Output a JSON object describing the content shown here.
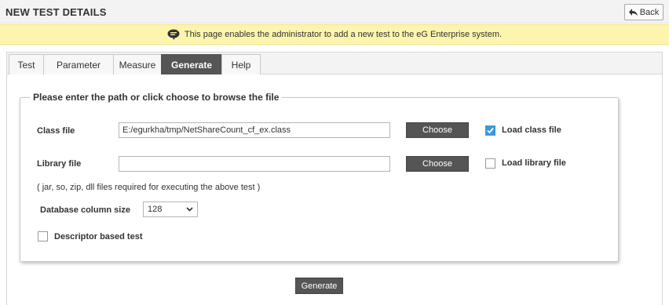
{
  "header": {
    "title": "NEW TEST DETAILS",
    "back_label": "Back"
  },
  "info": {
    "message": "This page enables the administrator to add a new test to the eG Enterprise system."
  },
  "tabs": [
    {
      "label": "Test",
      "active": false
    },
    {
      "label": "Parameter",
      "active": false
    },
    {
      "label": "Measure",
      "active": false
    },
    {
      "label": "Generate",
      "active": true
    },
    {
      "label": "Help",
      "active": false
    }
  ],
  "form": {
    "legend": "Please enter the path or click choose to browse the file",
    "class_file": {
      "label": "Class file",
      "value": "E:/egurkha/tmp/NetShareCount_cf_ex.class",
      "choose_label": "Choose",
      "load_label": "Load class file",
      "load_checked": true
    },
    "library_file": {
      "label": "Library file",
      "value": "",
      "choose_label": "Choose",
      "load_label": "Load library file",
      "load_checked": false
    },
    "note": "( jar, so, zip, dll files required for executing the above test )",
    "db_column_size": {
      "label": "Database column size",
      "value": "128"
    },
    "descriptor": {
      "label": "Descriptor based test",
      "checked": false
    }
  },
  "actions": {
    "generate_label": "Generate"
  },
  "colors": {
    "info_bar": "#fdf5ad",
    "active_tab": "#555555",
    "checkbox_checked": "#3a9ad9"
  }
}
